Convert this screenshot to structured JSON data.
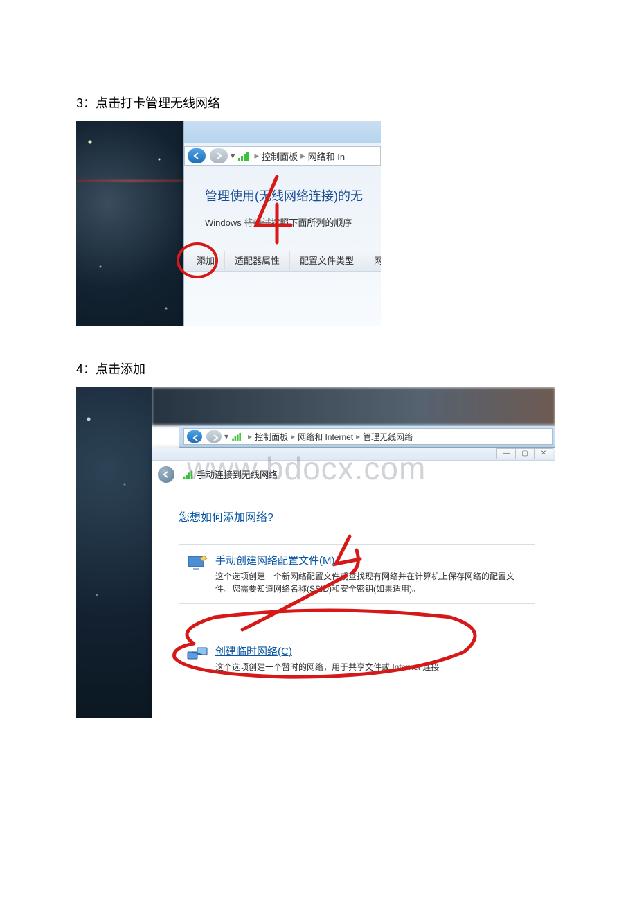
{
  "step3": {
    "caption": "3：点击打卡管理无线网络",
    "breadcrumb": {
      "item1": "控制面板",
      "item2": "网络和 In"
    },
    "heading": "管理使用(无线网络连接)的无",
    "subtext_prefix": "Windows ",
    "subtext_suffix": "按照下面所列的顺序",
    "toolbar": {
      "add": "添加",
      "adapter": "适配器属性",
      "profile": "配置文件类型",
      "net": "网"
    }
  },
  "step4": {
    "caption": "4：点击添加",
    "breadcrumb": {
      "item1": "控制面板",
      "item2": "网络和 Internet",
      "item3": "管理无线网络"
    },
    "wizard_title": "手动连接到无线网络",
    "prompt": "您想如何添加网络?",
    "option1": {
      "title": "手动创建网络配置文件(M)",
      "desc": "这个选项创建一个新网络配置文件或查找现有网络并在计算机上保存网络的配置文件。您需要知道网络名称(SSID)和安全密钥(如果适用)。"
    },
    "option2": {
      "title": "创建临时网络(C)",
      "desc": "这个选项创建一个暂时的网络，用于共享文件或 Internet 连接"
    },
    "watermark": "www.bdocx.com"
  }
}
